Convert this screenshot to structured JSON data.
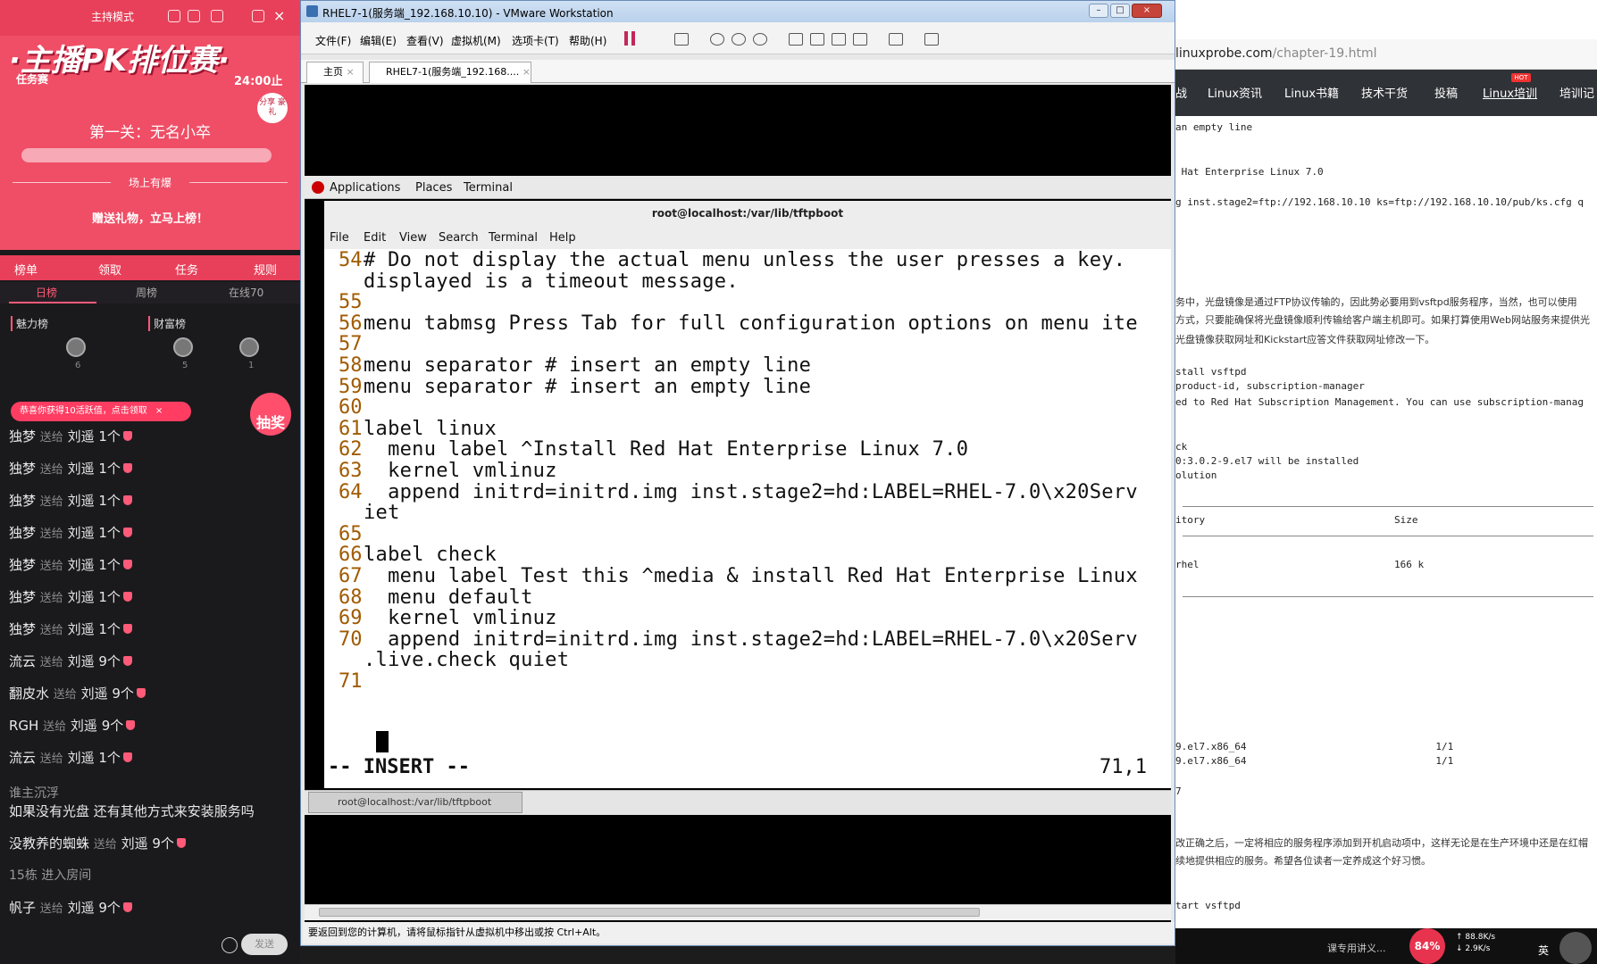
{
  "live": {
    "mode": "主持模式",
    "banner_title": "·主播PK排位赛·",
    "task": "任务赛",
    "time": "24:00止",
    "badge": "分享 豪礼",
    "stage": "第一关：无名小卒",
    "up_label": "场上有爆",
    "gift_cta": "赠送礼物，立马上榜！",
    "nav": [
      "榜单",
      "领取",
      "任务",
      "规则"
    ],
    "tabs": [
      "日榜",
      "周榜",
      "在线70"
    ],
    "rank_charm": "魅力榜",
    "rank_wealth": "财富榜",
    "avatar_nums": [
      "6",
      "5",
      "1"
    ],
    "notice": "恭喜你获得10活跃值，点击领取",
    "lottery": "抽奖",
    "messages": [
      {
        "user": "独梦",
        "verb": "送给",
        "target": "刘遥",
        "count": "1个"
      },
      {
        "user": "独梦",
        "verb": "送给",
        "target": "刘遥",
        "count": "1个"
      },
      {
        "user": "独梦",
        "verb": "送给",
        "target": "刘遥",
        "count": "1个"
      },
      {
        "user": "独梦",
        "verb": "送给",
        "target": "刘遥",
        "count": "1个"
      },
      {
        "user": "独梦",
        "verb": "送给",
        "target": "刘遥",
        "count": "1个"
      },
      {
        "user": "独梦",
        "verb": "送给",
        "target": "刘遥",
        "count": "1个"
      },
      {
        "user": "独梦",
        "verb": "送给",
        "target": "刘遥",
        "count": "1个"
      },
      {
        "user": "流云",
        "verb": "送给",
        "target": "刘遥",
        "count": "9个"
      },
      {
        "user": "翻皮水",
        "verb": "送给",
        "target": "刘遥",
        "count": "9个"
      },
      {
        "user": "RGH",
        "verb": "送给",
        "target": "刘遥",
        "count": "9个"
      },
      {
        "user": "流云",
        "verb": "送给",
        "target": "刘遥",
        "count": "1个"
      }
    ],
    "chat_user": "谁主沉浮",
    "chat_text": "如果没有光盘    还有其他方式来安装服务吗",
    "msg_after1": {
      "user": "没教养的蜘蛛",
      "verb": "送给",
      "target": "刘遥",
      "count": "9个"
    },
    "enter": "15栋 进入房间",
    "msg_after2": {
      "user": "帆子",
      "verb": "送给",
      "target": "刘遥",
      "count": "9个"
    },
    "send": "发送"
  },
  "vm": {
    "title": "RHEL7-1(服务端_192.168.10.10) - VMware Workstation",
    "menus": [
      "文件(F)",
      "编辑(E)",
      "查看(V)",
      "虚拟机(M)",
      "选项卡(T)",
      "帮助(H)"
    ],
    "tabs": [
      "主页",
      "RHEL7-1(服务端_192.168...."
    ],
    "gnome": [
      "Applications",
      "Places",
      "Terminal"
    ],
    "term_title": "root@localhost:/var/lib/tftpboot",
    "term_menu": [
      "File",
      "Edit",
      "View",
      "Search",
      "Terminal",
      "Help"
    ],
    "lines": [
      {
        "n": "54",
        "t": "# Do not display the actual menu unless the user presses a key."
      },
      {
        "n": "",
        "t": "displayed is a timeout message."
      },
      {
        "n": "55",
        "t": ""
      },
      {
        "n": "56",
        "t": "menu tabmsg Press Tab for full configuration options on menu ite"
      },
      {
        "n": "57",
        "t": ""
      },
      {
        "n": "58",
        "t": "menu separator # insert an empty line"
      },
      {
        "n": "59",
        "t": "menu separator # insert an empty line"
      },
      {
        "n": "60",
        "t": ""
      },
      {
        "n": "61",
        "t": "label linux"
      },
      {
        "n": "62",
        "t": "  menu label ^Install Red Hat Enterprise Linux 7.0"
      },
      {
        "n": "63",
        "t": "  kernel vmlinuz"
      },
      {
        "n": "64",
        "t": "  append initrd=initrd.img inst.stage2=hd:LABEL=RHEL-7.0\\x20Serv"
      },
      {
        "n": "",
        "t": "iet"
      },
      {
        "n": "65",
        "t": ""
      },
      {
        "n": "66",
        "t": "label check"
      },
      {
        "n": "67",
        "t": "  menu label Test this ^media & install Red Hat Enterprise Linux"
      },
      {
        "n": "68",
        "t": "  menu default"
      },
      {
        "n": "69",
        "t": "  kernel vmlinuz"
      },
      {
        "n": "70",
        "t": "  append initrd=initrd.img inst.stage2=hd:LABEL=RHEL-7.0\\x20Serv"
      },
      {
        "n": "",
        "t": ".live.check quiet"
      },
      {
        "n": "71",
        "t": ""
      }
    ],
    "mode": "-- INSERT --",
    "cursor_pos": "71,1",
    "taskbar_item": "root@localhost:/var/lib/tftpboot",
    "hint": "要返回到您的计算机，请将鼠标指针从虚拟机中移出或按 Ctrl+Alt。"
  },
  "web": {
    "url_domain": "linuxprobe.com",
    "url_path": "/chapter-19.html",
    "nav": [
      "战",
      "Linux资讯",
      "Linux书籍",
      "技术干货",
      "投稿",
      "Linux培训",
      "培训记"
    ],
    "hot": "HOT",
    "t1": "an empty line",
    "t2": " Hat Enterprise Linux 7.0",
    "t3": "g inst.stage2=ftp://192.168.10.10 ks=ftp://192.168.10.10/pub/ks.cfg q",
    "p1": "务中，光盘镜像是通过FTP协议传输的，因此势必要用到vsftpd服务程序，当然，也可以使用",
    "p2": "方式，只要能确保将光盘镜像顺利传输给客户端主机即可。如果打算使用Web网站服务来提供光",
    "p3": "光盘镜像获取网址和Kickstart应答文件获取网址修改一下。",
    "t4": "stall vsftpd",
    "t5": "product-id, subscription-manager",
    "t6": "ed to Red Hat Subscription Management. You can use subscription-manag",
    "t7": "ck",
    "t8": "0:3.0.2-9.el7 will be installed",
    "t9": "olution",
    "t10": "itory                                Size",
    "t11": "rhel                                 166 k",
    "t12": "9.el7.x86_64                                1/1",
    "t13": "9.el7.x86_64                                1/1",
    "t14": "7",
    "p4": "改正确之后，一定将相应的服务程序添加到开机启动项中，这样无论是在生产环境中还是在红帽",
    "p5": "续地提供相应的服务。希望各位读者一定养成这个好习惯。",
    "t15": "tart vsftpd"
  },
  "tray": {
    "battery": "84%",
    "up": "88.8K/s",
    "down": "2.9K/s",
    "lang": "英",
    "caption": "课专用讲义..."
  },
  "colors": {
    "live_accent": "#e8405a",
    "vim_linenum": "#a05a00"
  }
}
